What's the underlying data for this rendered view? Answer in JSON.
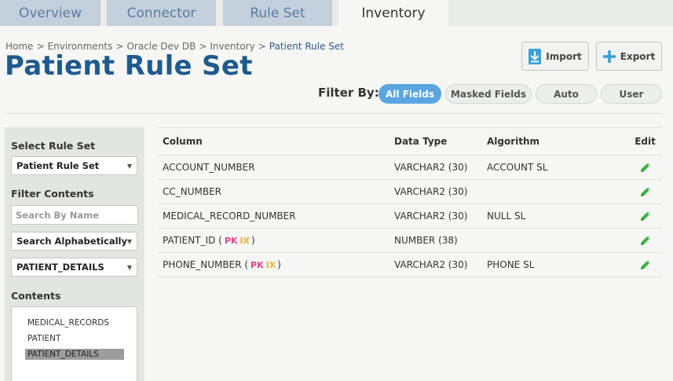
{
  "tabs": [
    {
      "label": "Overview",
      "active": false
    },
    {
      "label": "Connector",
      "active": false
    },
    {
      "label": "Rule Set",
      "active": false
    },
    {
      "label": "Inventory",
      "active": true
    }
  ],
  "breadcrumb": {
    "items": [
      "Home",
      "Environments",
      "Oracle Dev DB",
      "Inventory"
    ],
    "separator": ">",
    "current": "Patient Rule Set"
  },
  "page_title": "Patient Rule Set",
  "toolbar": {
    "import_label": "Import",
    "export_label": "Export"
  },
  "filter": {
    "label": "Filter By:",
    "options": [
      "All Fields",
      "Masked Fields",
      "Auto",
      "User"
    ],
    "selected": "All Fields"
  },
  "sidebar": {
    "select_rule_set_heading": "Select Rule Set",
    "rule_set_value": "Patient Rule Set",
    "filter_contents_heading": "Filter Contents",
    "search_placeholder": "Search By Name",
    "sort_value": "Search Alphabetically",
    "table_value": "PATIENT_DETAILS",
    "contents_heading": "Contents",
    "contents": [
      "MEDICAL_RECORDS",
      "PATIENT",
      "PATIENT_DETAILS"
    ],
    "selected_content": "PATIENT_DETAILS"
  },
  "table": {
    "headers": {
      "column": "Column",
      "data_type": "Data Type",
      "algorithm": "Algorithm",
      "edit": "Edit"
    },
    "rows": [
      {
        "column": "ACCOUNT_NUMBER",
        "pk": "",
        "ix": "",
        "data_type": "VARCHAR2 (30)",
        "algorithm": "ACCOUNT SL"
      },
      {
        "column": "CC_NUMBER",
        "pk": "",
        "ix": "",
        "data_type": "VARCHAR2 (30)",
        "algorithm": ""
      },
      {
        "column": "MEDICAL_RECORD_NUMBER",
        "pk": "",
        "ix": "",
        "data_type": "VARCHAR2 (30)",
        "algorithm": "NULL SL"
      },
      {
        "column": "PATIENT_ID",
        "pk": "PK",
        "ix": "IX",
        "data_type": "NUMBER (38)",
        "algorithm": ""
      },
      {
        "column": "PHONE_NUMBER",
        "pk": "PK",
        "ix": "IX",
        "data_type": "VARCHAR2 (30)",
        "algorithm": "PHONE SL"
      }
    ]
  },
  "colors": {
    "title_blue": "#1f5a8e",
    "active_pill": "#5aa5e0",
    "edit_green": "#3db33d",
    "pk_pink": "#e8408c",
    "ix_yellow": "#e5b62a",
    "tab_inactive": "#c3cfdb"
  },
  "icons": {
    "import": "import-arrow-icon",
    "export": "plus-icon",
    "edit": "pencil-icon",
    "select_caret": "caret-down-icon"
  }
}
